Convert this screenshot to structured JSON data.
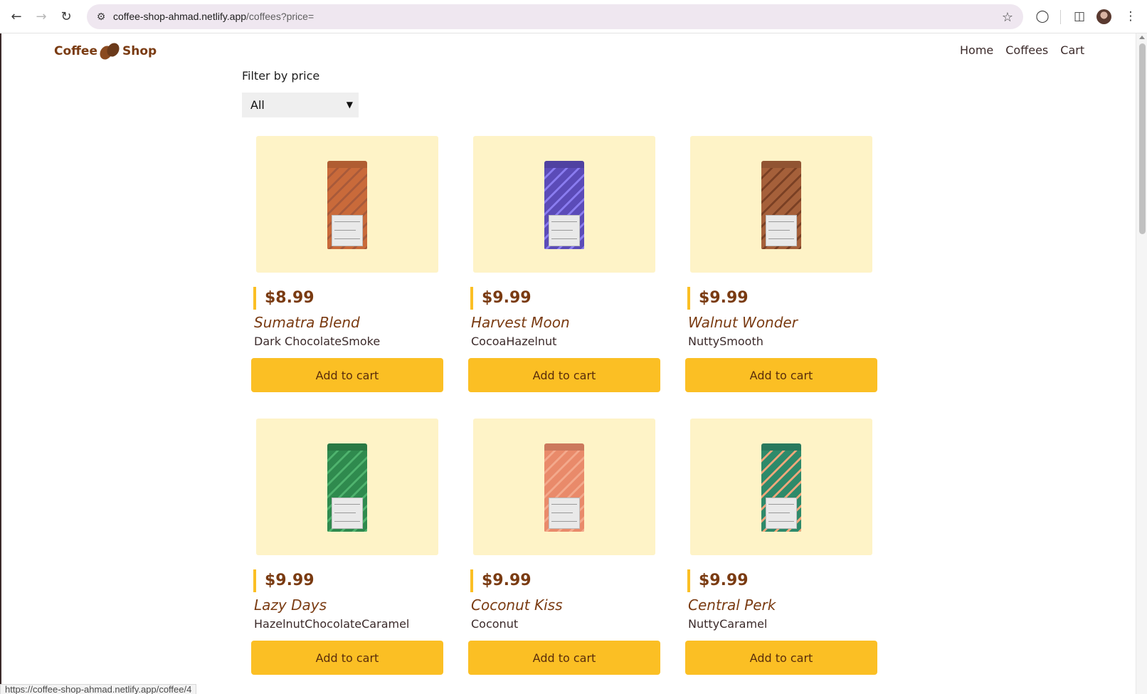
{
  "browser": {
    "url_host": "coffee-shop-ahmad.netlify.app",
    "url_path": "/coffees?price=",
    "status_url": "https://coffee-shop-ahmad.netlify.app/coffee/4"
  },
  "site": {
    "logo_left": "Coffee",
    "logo_right": "Shop",
    "nav": [
      {
        "label": "Home"
      },
      {
        "label": "Coffees"
      },
      {
        "label": "Cart"
      }
    ]
  },
  "filter": {
    "label": "Filter by price",
    "selected": "All"
  },
  "products": [
    {
      "price": "$8.99",
      "name": "Sumatra Blend",
      "flavors": "Dark ChocolateSmoke",
      "button": "Add to cart",
      "bag_color": "#c96a3a",
      "accent": "#a85a3a"
    },
    {
      "price": "$9.99",
      "name": "Harvest Moon",
      "flavors": "CocoaHazelnut",
      "button": "Add to cart",
      "bag_color": "#5b4bb8",
      "accent": "#8a7cf0"
    },
    {
      "price": "$9.99",
      "name": "Walnut Wonder",
      "flavors": "NuttySmooth",
      "button": "Add to cart",
      "bag_color": "#a5603a",
      "accent": "#7a4024"
    },
    {
      "price": "$9.99",
      "name": "Lazy Days",
      "flavors": "HazelnutChocolateCaramel",
      "button": "Add to cart",
      "bag_color": "#2f8a4e",
      "accent": "#4fb36e"
    },
    {
      "price": "$9.99",
      "name": "Coconut Kiss",
      "flavors": "Coconut",
      "button": "Add to cart",
      "bag_color": "#e98a6a",
      "accent": "#f3a98c"
    },
    {
      "price": "$9.99",
      "name": "Central Perk",
      "flavors": "NuttyCaramel",
      "button": "Add to cart",
      "bag_color": "#2e8a6a",
      "accent": "#f0a77a"
    }
  ],
  "colors": {
    "brand_brown": "#7a3b12",
    "button_yellow": "#fbbf24",
    "card_bg": "#fef3c7"
  }
}
